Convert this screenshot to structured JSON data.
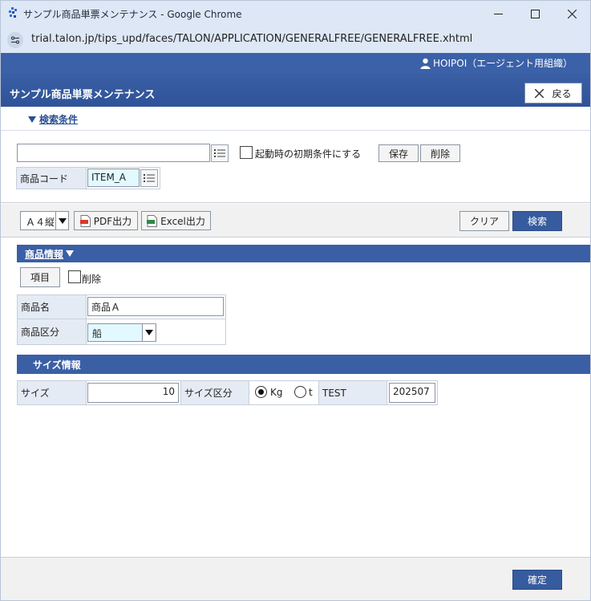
{
  "window": {
    "title": "サンプル商品単票メンテナンス - Google Chrome",
    "url": "trial.talon.jp/tips_upd/faces/TALON/APPLICATION/GENERALFREE/GENERALFREE.xhtml"
  },
  "header": {
    "user": "HOIPOI（エージェント用組織）",
    "screen_title": "サンプル商品単票メンテナンス",
    "back_label": "戻る"
  },
  "search": {
    "toggle_label": "検索条件",
    "condition_name_value": "",
    "initial_condition_label": "起動時の初期条件にする",
    "save_label": "保存",
    "delete_label": "削除",
    "product_code_label": "商品コード",
    "product_code_value": "ITEM_A"
  },
  "toolbar": {
    "paper_size": "Ａ４縦",
    "pdf_label": "PDF出力",
    "excel_label": "Excel出力",
    "clear_label": "クリア",
    "search_label": "検索"
  },
  "product_section": {
    "title": "商品情報",
    "item_button": "項目",
    "delete_checkbox_label": "削除",
    "name_label": "商品名",
    "name_value": "商品Ａ",
    "category_label": "商品区分",
    "category_value": "船"
  },
  "size_section": {
    "title": "サイズ情報",
    "size_label": "サイズ",
    "size_value": "10",
    "size_type_label": "サイズ区分",
    "radio_kg": "Kg",
    "radio_t": "t",
    "selected_unit": "Kg",
    "test_label": "TEST",
    "test_value": "202507"
  },
  "footer": {
    "confirm_label": "確定"
  }
}
